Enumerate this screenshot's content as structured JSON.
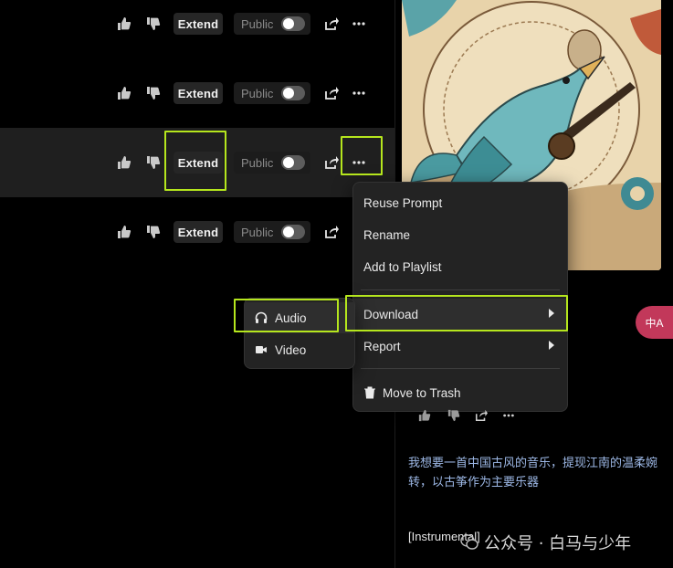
{
  "songs": [
    {
      "extend_label": "Extend",
      "public_label": "Public"
    },
    {
      "extend_label": "Extend",
      "public_label": "Public"
    },
    {
      "extend_label": "Extend",
      "public_label": "Public"
    },
    {
      "extend_label": "Extend",
      "public_label": "Public"
    }
  ],
  "context_menu": {
    "items": [
      {
        "label": "Reuse Prompt"
      },
      {
        "label": "Rename"
      },
      {
        "label": "Add to Playlist"
      },
      {
        "label": "Download"
      },
      {
        "label": "Report"
      },
      {
        "label": "Move to Trash"
      }
    ]
  },
  "download_submenu": {
    "items": [
      {
        "label": "Audio",
        "icon": "headphones-icon"
      },
      {
        "label": "Video",
        "icon": "video-camera-icon"
      }
    ]
  },
  "detail": {
    "prompt": "我想要一首中国古风的音乐，提现江南的温柔婉转，以古筝作为主要乐器",
    "lyrics_tag": "[Instrumental]",
    "translate_label": "中A"
  },
  "watermark": {
    "text": "公众号 · 白马与少年"
  },
  "colors": {
    "highlight": "#b5e61d",
    "translate": "#c2385a",
    "prompt_text": "#9db8e6"
  }
}
